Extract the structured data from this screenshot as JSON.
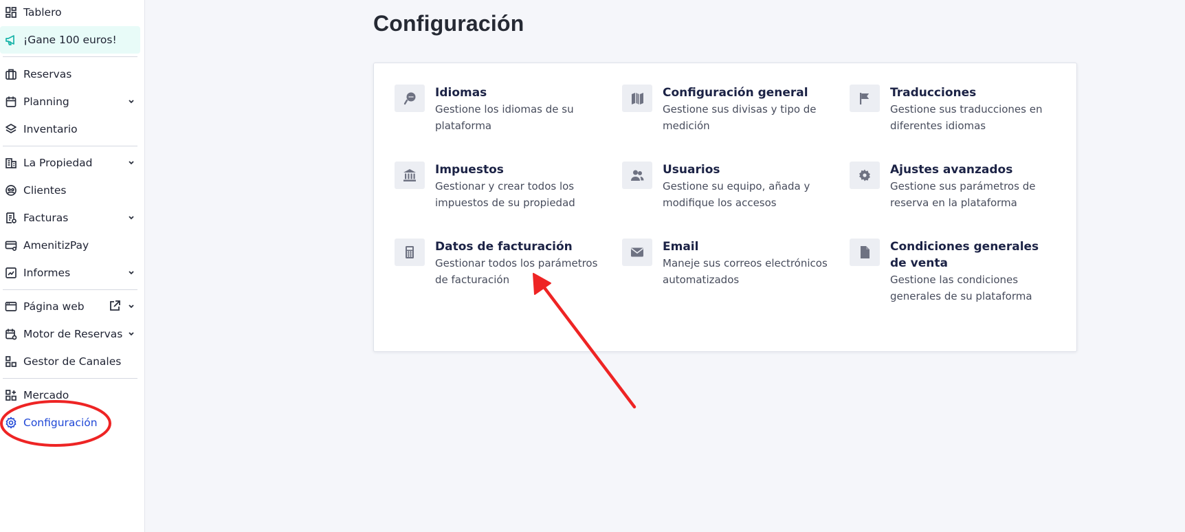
{
  "sidebar": {
    "items": [
      {
        "label": "Tablero",
        "icon": "dashboard-icon"
      },
      {
        "label": "¡Gane 100 euros!",
        "icon": "megaphone-icon"
      },
      {
        "label": "Reservas",
        "icon": "suitcase-icon"
      },
      {
        "label": "Planning",
        "icon": "calendar-icon",
        "expandable": true
      },
      {
        "label": "Inventario",
        "icon": "layers-icon"
      },
      {
        "label": "La Propiedad",
        "icon": "building-icon",
        "expandable": true
      },
      {
        "label": "Clientes",
        "icon": "guests-icon"
      },
      {
        "label": "Facturas",
        "icon": "invoice-icon",
        "expandable": true
      },
      {
        "label": "AmenitizPay",
        "icon": "card-icon"
      },
      {
        "label": "Informes",
        "icon": "chart-icon",
        "expandable": true
      },
      {
        "label": "Página web",
        "icon": "browser-icon",
        "expandable": true,
        "external": true
      },
      {
        "label": "Motor de Reservas",
        "icon": "booking-engine-icon",
        "expandable": true
      },
      {
        "label": "Gestor de Canales",
        "icon": "channels-icon"
      },
      {
        "label": "Mercado",
        "icon": "market-icon"
      },
      {
        "label": "Configuración",
        "icon": "gear-icon",
        "active": true
      }
    ]
  },
  "main": {
    "title": "Configuración",
    "tiles": [
      {
        "title": "Idiomas",
        "desc": "Gestione los idiomas de su plataforma",
        "icon": "chat-icon"
      },
      {
        "title": "Configuración general",
        "desc": "Gestione sus divisas y tipo de medición",
        "icon": "map-icon"
      },
      {
        "title": "Traducciones",
        "desc": "Gestione sus traducciones en diferentes idiomas",
        "icon": "flag-icon"
      },
      {
        "title": "Impuestos",
        "desc": "Gestionar y crear todos los impuestos de su propiedad",
        "icon": "bank-icon"
      },
      {
        "title": "Usuarios",
        "desc": "Gestione su equipo, añada y modifique los accesos",
        "icon": "users-icon"
      },
      {
        "title": "Ajustes avanzados",
        "desc": "Gestione sus parámetros de reserva en la plataforma",
        "icon": "cog-icon"
      },
      {
        "title": "Datos de facturación",
        "desc": "Gestionar todos los parámetros de facturación",
        "icon": "calculator-icon"
      },
      {
        "title": "Email",
        "desc": "Maneje sus correos electrónicos automatizados",
        "icon": "envelope-icon"
      },
      {
        "title": "Condiciones generales de venta",
        "desc": "Gestione las condiciones generales de su plataforma",
        "icon": "document-icon"
      }
    ]
  },
  "colors": {
    "accent": "#1f47d6",
    "promo_bg": "#e8fbf8",
    "annotation": "#ee2424"
  }
}
